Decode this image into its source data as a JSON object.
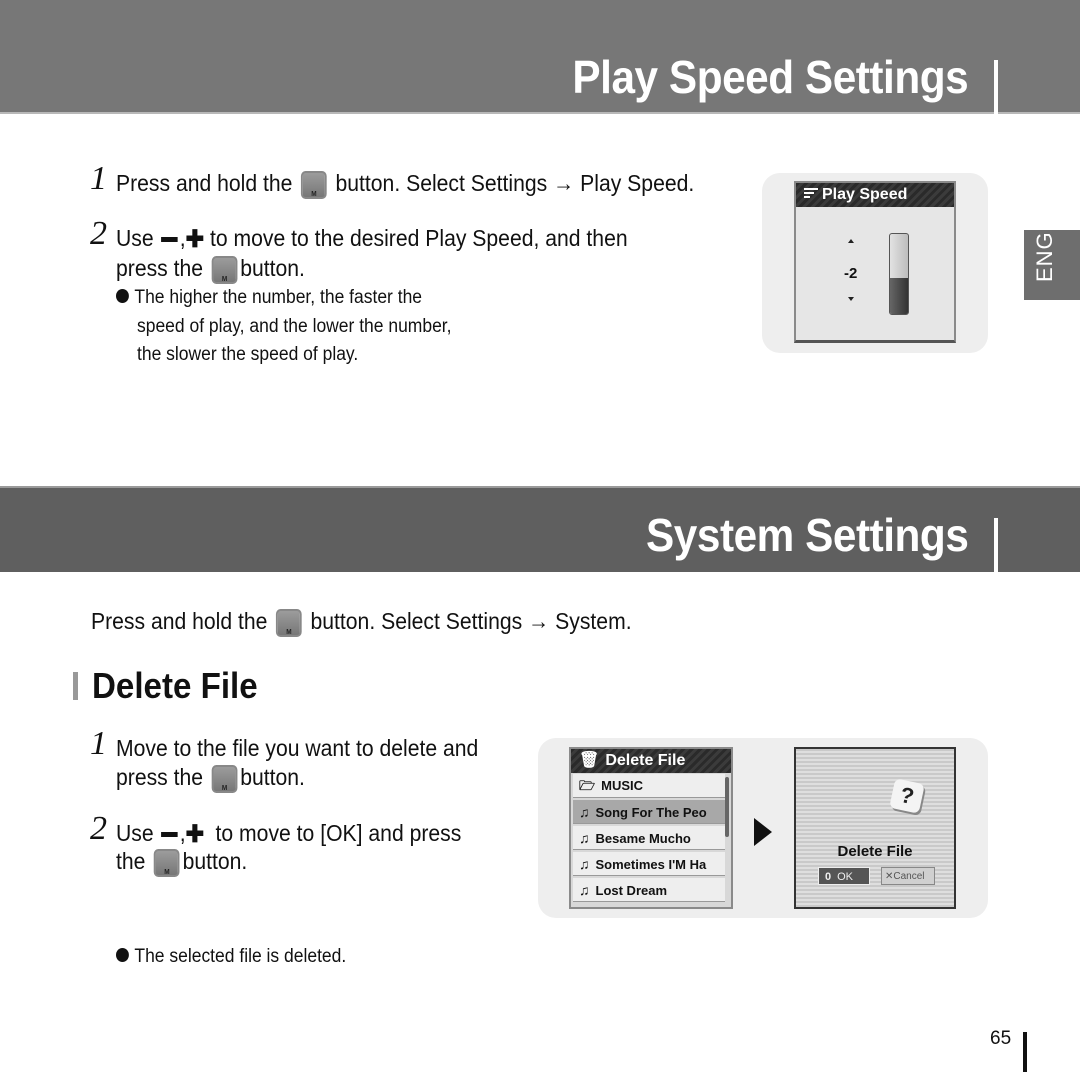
{
  "sections": {
    "play_speed": {
      "title": "Play Speed Settings",
      "step1": {
        "num": "1",
        "pre": "Press and hold the",
        "post": "button. Select Settings → Play Speed."
      },
      "step2": {
        "num": "2",
        "pre": "Use",
        "sep": ",",
        "mid": "to move to the desired Play Speed, and then",
        "line2_pre": "press the",
        "line2_post": "button."
      },
      "bullet_lines": [
        "The higher the number, the faster the",
        "speed of play, and the lower the number,",
        "the slower the speed of play."
      ],
      "screen": {
        "header": "Play Speed",
        "value": "-2",
        "level_fraction": 0.45
      }
    },
    "system": {
      "title": "System Settings",
      "intro": {
        "pre": "Press and hold the",
        "post": "button. Select Settings → System."
      },
      "subheading": "Delete File",
      "step1": {
        "num": "1",
        "line1": "Move to the file you want to delete and",
        "line2_pre": "press the",
        "line2_post": "button."
      },
      "step2": {
        "num": "2",
        "pre": "Use",
        "sep": ",",
        "mid": "to move to [OK] and press",
        "line2_pre": "the",
        "line2_post": "button."
      },
      "bullet": "The selected file is deleted.",
      "list_screen": {
        "header": "Delete File",
        "folder": "MUSIC",
        "items": [
          "Song For The Peo",
          "Besame Mucho",
          "Sometimes I'M Ha",
          "Lost Dream"
        ],
        "selected_index": 0
      },
      "confirm_screen": {
        "title": "Delete File",
        "ok": "OK",
        "cancel": "Cancel"
      }
    }
  },
  "m_button_label": "M",
  "lang_tab": "ENG",
  "page_number": "65"
}
